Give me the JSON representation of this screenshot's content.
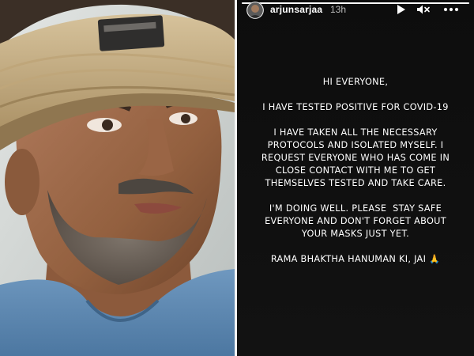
{
  "story": {
    "username": "arjunsarjaa",
    "time_ago": "13h",
    "progress_fraction": 1.0,
    "accent_color": "#ffffff",
    "background_color": "#0f0f0f",
    "controls": {
      "play_icon": "play-icon",
      "mute_icon": "mute-icon",
      "more_icon": "more-options-icon"
    },
    "message": {
      "greeting": "HI EVERYONE,",
      "line_positive": "I HAVE TESTED POSITIVE FOR COVID-19",
      "para2": [
        "I HAVE TAKEN ALL THE NECESSARY",
        "PROTOCOLS AND ISOLATED MYSELF. I",
        "REQUEST EVERYONE WHO HAS COME IN",
        "CLOSE CONTACT WITH ME TO GET",
        "THEMSELVES TESTED AND TAKE CARE."
      ],
      "para3": [
        "I'M DOING WELL. PLEASE  STAY SAFE",
        "EVERYONE AND DON'T FORGET ABOUT",
        "YOUR MASKS JUST YET."
      ],
      "closing": "RAMA BHAKTHA HANUMAN KI, JAI",
      "closing_emoji": "🙏"
    }
  }
}
